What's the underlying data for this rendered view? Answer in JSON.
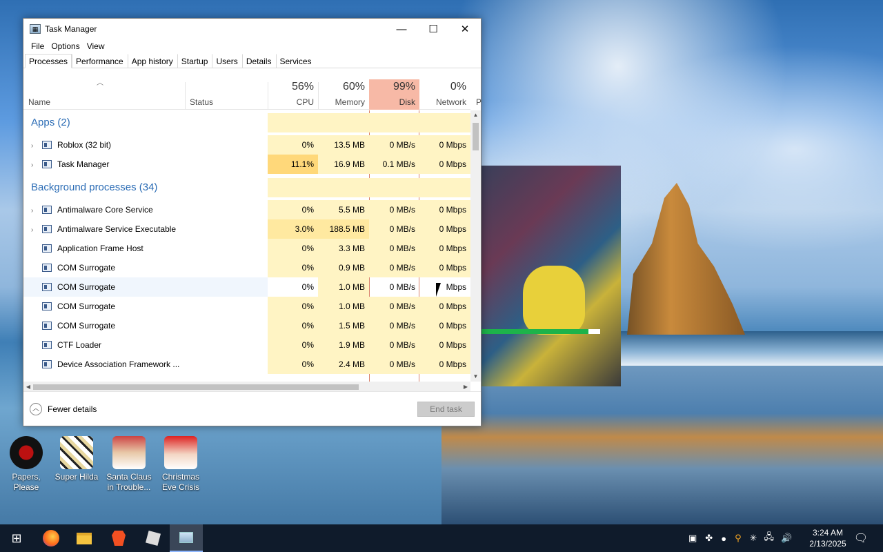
{
  "window": {
    "title": "Task Manager",
    "app_icon": "task-manager-icon",
    "controls": {
      "minimize": "—",
      "maximize": "☐",
      "close": "✕"
    }
  },
  "menu": [
    "File",
    "Options",
    "View"
  ],
  "tabs": [
    "Processes",
    "Performance",
    "App history",
    "Startup",
    "Users",
    "Details",
    "Services"
  ],
  "active_tab": "Processes",
  "columns": {
    "name": "Name",
    "status": "Status",
    "cpu": {
      "pct": "56%",
      "label": "CPU"
    },
    "memory": {
      "pct": "60%",
      "label": "Memory"
    },
    "disk": {
      "pct": "99%",
      "label": "Disk"
    },
    "network": {
      "pct": "0%",
      "label": "Network"
    },
    "power_partial": "P"
  },
  "groups": {
    "apps": "Apps (2)",
    "background": "Background processes (34)"
  },
  "rows": [
    {
      "name": "Roblox (32 bit)",
      "cpu": "0%",
      "mem": "13.5 MB",
      "disk": "0 MB/s",
      "net": "0 Mbps"
    },
    {
      "name": "Task Manager",
      "cpu": "11.1%",
      "mem": "16.9 MB",
      "disk": "0.1 MB/s",
      "net": "0 Mbps"
    },
    {
      "name": "Antimalware Core Service",
      "cpu": "0%",
      "mem": "5.5 MB",
      "disk": "0 MB/s",
      "net": "0 Mbps"
    },
    {
      "name": "Antimalware Service Executable",
      "cpu": "3.0%",
      "mem": "188.5 MB",
      "disk": "0 MB/s",
      "net": "0 Mbps"
    },
    {
      "name": "Application Frame Host",
      "cpu": "0%",
      "mem": "3.3 MB",
      "disk": "0 MB/s",
      "net": "0 Mbps"
    },
    {
      "name": "COM Surrogate",
      "cpu": "0%",
      "mem": "0.9 MB",
      "disk": "0 MB/s",
      "net": "0 Mbps"
    },
    {
      "name": "COM Surrogate",
      "cpu": "0%",
      "mem": "1.0 MB",
      "disk": "0 MB/s",
      "net": "Mbps"
    },
    {
      "name": "COM Surrogate",
      "cpu": "0%",
      "mem": "1.0 MB",
      "disk": "0 MB/s",
      "net": "0 Mbps"
    },
    {
      "name": "COM Surrogate",
      "cpu": "0%",
      "mem": "1.5 MB",
      "disk": "0 MB/s",
      "net": "0 Mbps"
    },
    {
      "name": "CTF Loader",
      "cpu": "0%",
      "mem": "1.9 MB",
      "disk": "0 MB/s",
      "net": "0 Mbps"
    },
    {
      "name": "Device Association Framework ...",
      "cpu": "0%",
      "mem": "2.4 MB",
      "disk": "0 MB/s",
      "net": "0 Mbps"
    }
  ],
  "footer": {
    "fewer_details": "Fewer details",
    "end_task": "End task"
  },
  "desktop_icons": [
    {
      "label": "Papers, Please"
    },
    {
      "label": "Super Hilda"
    },
    {
      "label": "Santa Claus in Trouble..."
    },
    {
      "label": "Christmas Eve Crisis"
    }
  ],
  "overlay_progress": 0.9,
  "taskbar": {
    "time": "3:24 AM",
    "date": "2/13/2025",
    "icons": [
      "windows-start-icon",
      "firefox-icon",
      "file-explorer-icon",
      "brave-icon",
      "roblox-icon",
      "task-manager-icon"
    ]
  },
  "colors": {
    "disk_header": "#f7b9a6",
    "heat_light": "#fff4c4",
    "heat_mid": "#ffe9a0",
    "heat_high": "#ffd87a",
    "group_blue": "#2b6cb5"
  }
}
